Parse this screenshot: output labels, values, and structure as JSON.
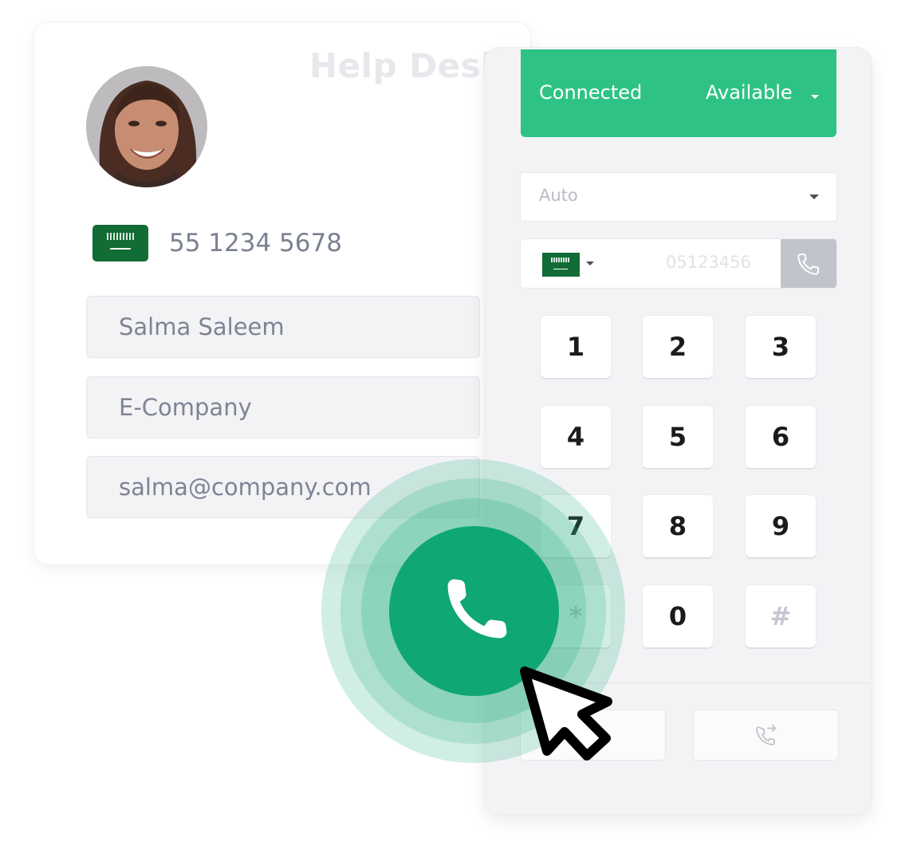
{
  "contact_card": {
    "title": "Help Desk",
    "avatar_alt": "Salma Saleem photo",
    "flag": "saudi-arabia-flag",
    "phone_number": "55 1234 5678",
    "fields": {
      "name": "Salma Saleem",
      "company": "E-Company",
      "email": "salma@company.com"
    }
  },
  "dialer": {
    "status": {
      "connection": "Connected",
      "availability": "Available"
    },
    "mode_select": {
      "value": "Auto"
    },
    "dial_input": {
      "country_flag": "saudi-arabia-flag",
      "placeholder": "05123456"
    },
    "keypad": [
      "1",
      "2",
      "3",
      "4",
      "5",
      "6",
      "7",
      "8",
      "9",
      "*",
      "0",
      "#"
    ],
    "bottom_actions": [
      {
        "icon": "blank"
      },
      {
        "icon": "call-transfer-icon"
      }
    ]
  },
  "colors": {
    "status_green": "#2ec384",
    "call_button_green": "#0fa776",
    "field_text": "#7d8494"
  }
}
